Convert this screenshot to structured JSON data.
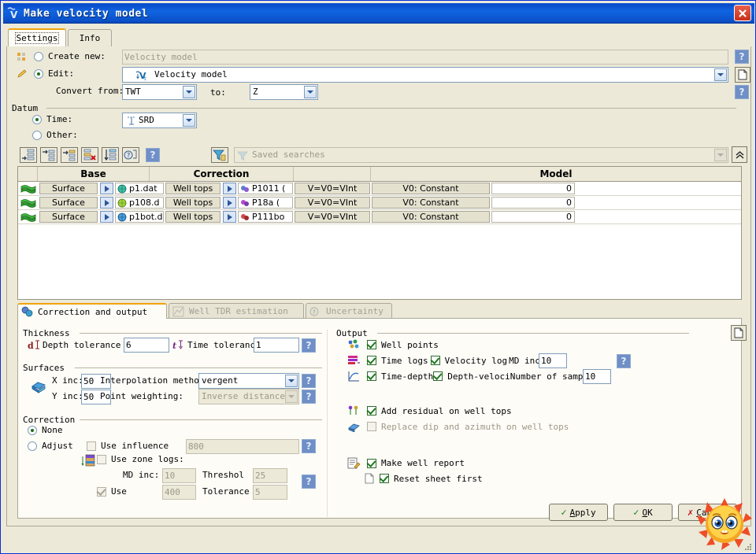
{
  "window": {
    "title": "Make velocity model",
    "close_label": "✕",
    "icon": "velocity-model-icon"
  },
  "top_tabs": [
    {
      "label": "Settings",
      "selected": true
    },
    {
      "label": "Info",
      "selected": false
    }
  ],
  "settings": {
    "create_new": {
      "label": "Create new:",
      "selected": false,
      "placeholder": "Velocity model",
      "value": ""
    },
    "edit": {
      "label": "Edit:",
      "selected": true,
      "value": "Velocity model"
    },
    "convert_from": {
      "label": "Convert from:",
      "value": "TWT"
    },
    "convert_to": {
      "label": "to:",
      "value": "Z"
    },
    "datum": {
      "legend": "Datum",
      "time": {
        "label": "Time:",
        "selected": true,
        "value": "SRD"
      },
      "other": {
        "label": "Other:",
        "selected": false
      }
    }
  },
  "toolbar": {
    "buttons": [
      "insert-row-icon",
      "insert-child-icon",
      "insert-sibling-icon",
      "delete-row-icon",
      "sort-rows-icon",
      "row-help-icon"
    ],
    "help_label": "?",
    "filter_icon": "filter-icon",
    "saved_searches_placeholder": "Saved searches",
    "collapse_label": "«"
  },
  "table": {
    "headers": [
      "Base",
      "Correction",
      "Model"
    ],
    "rows": [
      {
        "marker": "surface-icon",
        "base_type": "Surface",
        "base_name": "p1.dat",
        "correction_type": "Well tops",
        "correction_name": "P1011 (",
        "formula": "V=V0=VInt",
        "model": "V0: Constant",
        "value": "0"
      },
      {
        "marker": "surface-icon",
        "base_type": "Surface",
        "base_name": "p108.d",
        "correction_type": "Well tops",
        "correction_name": "P18a (",
        "formula": "V=V0=VInt",
        "model": "V0: Constant",
        "value": "0"
      },
      {
        "marker": "surface-icon",
        "base_type": "Surface",
        "base_name": "p1bot.d",
        "correction_type": "Well tops",
        "correction_name": "P111bo",
        "formula": "V=V0=VInt",
        "model": "V0: Constant",
        "value": "0"
      }
    ]
  },
  "bottom_tabs": [
    {
      "label": "Correction and output",
      "icon": "correction-icon",
      "selected": true
    },
    {
      "label": "Well TDR estimation",
      "icon": "chart-icon",
      "selected": false
    },
    {
      "label": "Uncertainty",
      "icon": "help-circle-icon",
      "selected": false
    }
  ],
  "correction_output": {
    "thickness": {
      "legend": "Thickness",
      "depth_tolerance": {
        "label": "Depth tolerance",
        "value": "6"
      },
      "time_tolerance": {
        "label": "Time tolerance:",
        "value": "1"
      }
    },
    "surfaces": {
      "legend": "Surfaces",
      "x_inc": {
        "label": "X inc:",
        "value": "50"
      },
      "y_inc": {
        "label": "Y inc:",
        "value": "50"
      },
      "interpolation": {
        "label": "Interpolation method:",
        "value": "vergent"
      },
      "point_weighting": {
        "label": "Point weighting:",
        "value": "Inverse distance"
      }
    },
    "correction": {
      "legend": "Correction",
      "none": {
        "label": "None",
        "selected": true
      },
      "adjust": {
        "label": "Adjust",
        "selected": false
      },
      "use_influence": {
        "label": "Use influence",
        "checked": false,
        "value": "800"
      },
      "use_zone_logs": {
        "label": "Use zone logs:",
        "checked": false
      },
      "md_inc": {
        "label": "MD inc:",
        "value": "10"
      },
      "threshold": {
        "label": "Threshol",
        "value": "25"
      },
      "use": {
        "label": "Use",
        "checked": true,
        "value": "400"
      },
      "tolerance": {
        "label": "Tolerance",
        "value": "5"
      }
    },
    "output": {
      "legend": "Output",
      "well_points": {
        "label": "Well points",
        "checked": true,
        "icon": "well-points-icon"
      },
      "time_logs": {
        "label": "Time logs",
        "checked": true,
        "icon": "time-logs-icon"
      },
      "velocity_log": {
        "label": "Velocity log",
        "checked": true
      },
      "md_inc": {
        "label": "MD inc:",
        "value": "10"
      },
      "time_depth": {
        "label": "Time-depth",
        "checked": true,
        "icon": "time-depth-icon"
      },
      "depth_velocity": {
        "label": "Depth-veloci",
        "checked": true
      },
      "num_samples": {
        "label": "Number of samples:",
        "value": "10"
      },
      "add_residual": {
        "label": "Add residual on well tops",
        "checked": true,
        "icon": "residual-icon"
      },
      "replace_dip": {
        "label": "Replace dip and azimuth on well tops",
        "checked": false,
        "icon": "dip-icon"
      },
      "make_well_report": {
        "label": "Make well report",
        "checked": true,
        "icon": "report-icon"
      },
      "reset_sheet": {
        "label": "Reset sheet first",
        "checked": true,
        "icon": "sheet-icon"
      }
    }
  },
  "dialog_buttons": [
    {
      "label": "Apply",
      "accel": "A",
      "icon": "check-icon"
    },
    {
      "label": "OK",
      "accel": "O",
      "icon": "check-icon"
    },
    {
      "label": "Cancel",
      "accel": "C",
      "icon": "cross-icon"
    }
  ],
  "overlay": {
    "sticker": "sun-face-emoji"
  },
  "colors": {
    "titlebar": "#0a50c8",
    "face": "#ece9d8",
    "tab_accent": "#f0a30a",
    "field_border": "#7f9db9"
  }
}
